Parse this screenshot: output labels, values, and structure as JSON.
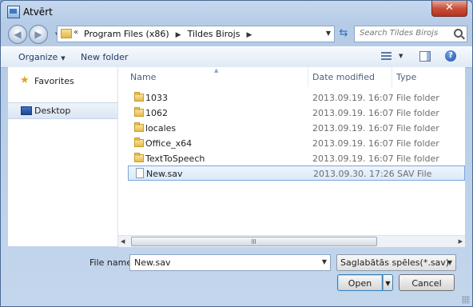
{
  "window": {
    "title": "Atvērt",
    "close_label": "✕"
  },
  "nav": {
    "breadcrumb": [
      "Program Files (x86)",
      "Tildes Birojs"
    ],
    "breadcrumb_prefix": "«",
    "search_placeholder": "Search Tildes Birojs"
  },
  "toolbar": {
    "organize_label": "Organize",
    "new_folder_label": "New folder",
    "help_label": "?"
  },
  "sidebar": {
    "items": [
      {
        "label": "Favorites",
        "icon": "star-icon"
      },
      {
        "label": "Desktop",
        "icon": "desktop-icon",
        "selected": true
      }
    ]
  },
  "files": {
    "columns": {
      "name": "Name",
      "date": "Date modified",
      "type": "Type"
    },
    "rows": [
      {
        "name": "1033",
        "date": "2013.09.19. 16:07",
        "type": "File folder",
        "icon": "folder-icon"
      },
      {
        "name": "1062",
        "date": "2013.09.19. 16:07",
        "type": "File folder",
        "icon": "folder-icon"
      },
      {
        "name": "locales",
        "date": "2013.09.19. 16:07",
        "type": "File folder",
        "icon": "folder-icon"
      },
      {
        "name": "Office_x64",
        "date": "2013.09.19. 16:07",
        "type": "File folder",
        "icon": "folder-icon"
      },
      {
        "name": "TextToSpeech",
        "date": "2013.09.19. 16:07",
        "type": "File folder",
        "icon": "folder-icon"
      },
      {
        "name": "New.sav",
        "date": "2013.09.30. 17:26",
        "type": "SAV File",
        "icon": "file-icon",
        "selected": true
      }
    ]
  },
  "footer": {
    "filename_label": "File name:",
    "filename_value": "New.sav",
    "filter_value": "Saglabātās spēles(*.sav)",
    "open_label": "Open",
    "cancel_label": "Cancel"
  },
  "colors": {
    "accent": "#3c7fb1",
    "selection": "#dbe9f9",
    "titlebar": "#b5cbe6"
  }
}
